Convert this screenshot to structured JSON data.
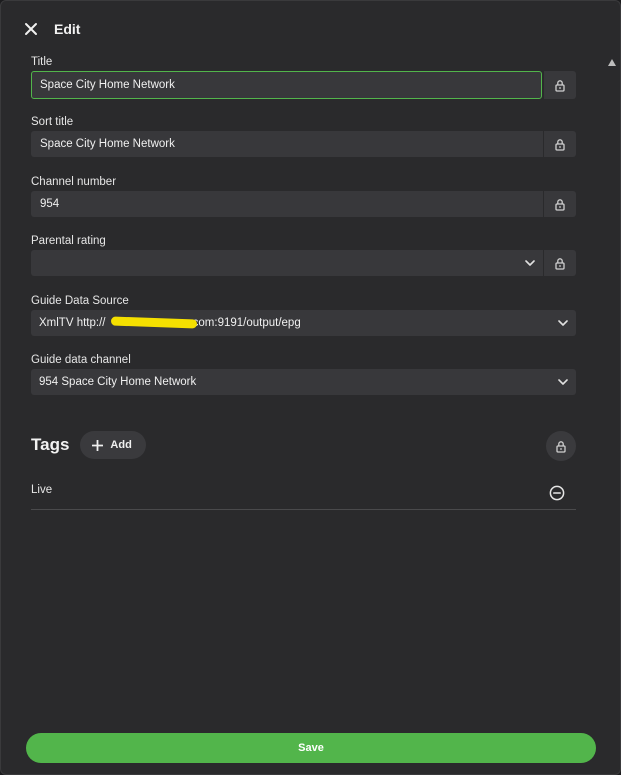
{
  "header": {
    "title": "Edit"
  },
  "fields": {
    "title": {
      "label": "Title",
      "value": "Space City Home Network"
    },
    "sort_title": {
      "label": "Sort title",
      "value": "Space City Home Network"
    },
    "channel_number": {
      "label": "Channel number",
      "value": "954"
    },
    "parental_rating": {
      "label": "Parental rating",
      "value": ""
    },
    "guide_source": {
      "label": "Guide Data Source",
      "value_prefix": "XmlTV http://",
      "value_suffix": ".com:9191/output/epg"
    },
    "guide_channel": {
      "label": "Guide data channel",
      "value": "954 Space City Home Network"
    }
  },
  "tags": {
    "title": "Tags",
    "add_label": "Add",
    "items": [
      {
        "name": "Live"
      }
    ]
  },
  "footer": {
    "save_label": "Save"
  },
  "colors": {
    "accent": "#52b54b",
    "background": "#2a2a2c",
    "input": "#38383b"
  }
}
